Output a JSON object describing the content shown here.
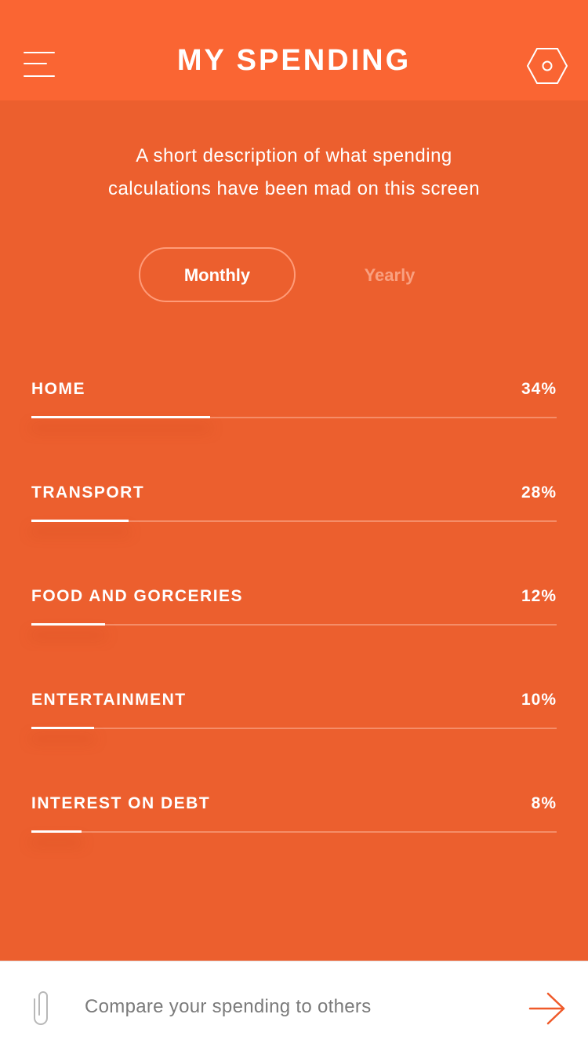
{
  "header": {
    "title": "MY SPENDING",
    "menu_icon": "hamburger-menu-icon",
    "settings_icon": "hexagon-settings-icon"
  },
  "description": {
    "line1": "A short description of what spending",
    "line2": "calculations have been mad on this screen"
  },
  "tabs": {
    "monthly": "Monthly",
    "yearly": "Yearly",
    "selected": "Monthly"
  },
  "categories": [
    {
      "label": "HOME",
      "value_text": "34%",
      "fill_fraction": 0.34
    },
    {
      "label": "TRANSPORT",
      "value_text": "28%",
      "fill_fraction": 0.185
    },
    {
      "label": "FOOD AND GORCERIES",
      "value_text": "12%",
      "fill_fraction": 0.14
    },
    {
      "label": "ENTERTAINMENT",
      "value_text": "10%",
      "fill_fraction": 0.12
    },
    {
      "label": "INTEREST ON DEBT",
      "value_text": "8%",
      "fill_fraction": 0.095
    }
  ],
  "footer": {
    "text": "Compare your spending to others",
    "clip_icon": "paperclip-icon",
    "arrow_icon": "arrow-right-icon"
  },
  "colors": {
    "background": "#ec5f2e",
    "header_background": "#fa6533",
    "accent": "#ef5a2a",
    "text_primary": "#ffffff",
    "footer_text": "#7a7a7a"
  }
}
